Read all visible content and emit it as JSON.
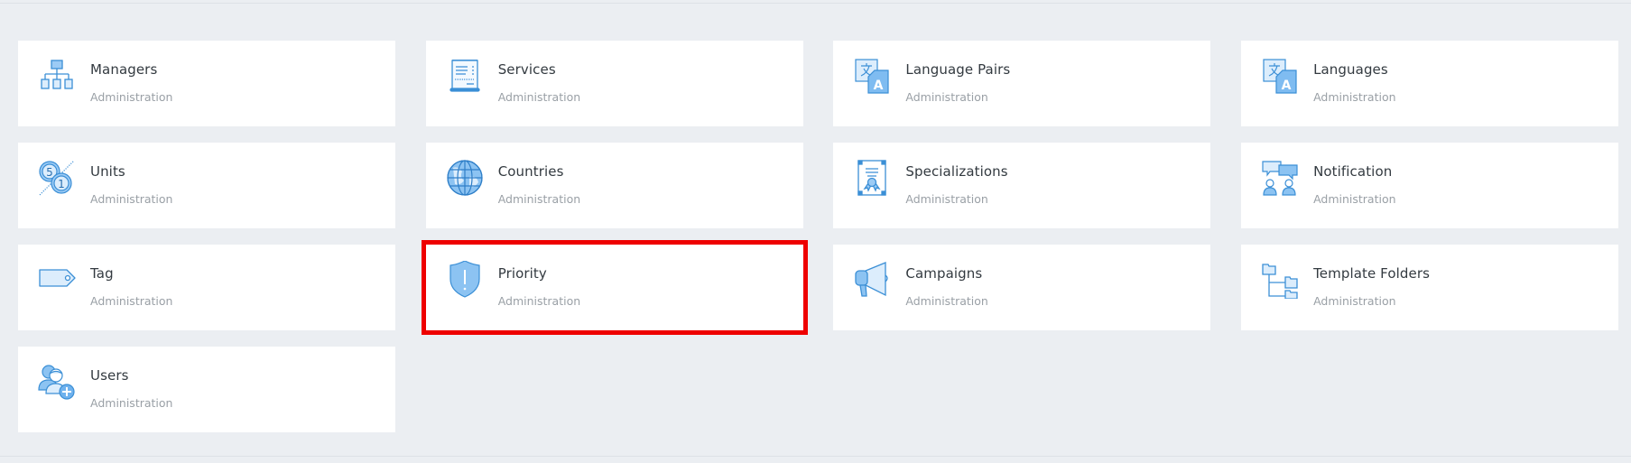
{
  "colors": {
    "background": "#ebeef2",
    "card": "#ffffff",
    "icon_stroke": "#3b8fd6",
    "icon_fill": "#9ccbf5",
    "icon_fill_light": "#dcedfc",
    "highlight": "#ee0000",
    "title": "#333a40",
    "subtitle": "#9aa0a6"
  },
  "cards": [
    {
      "title": "Managers",
      "subtitle": "Administration",
      "icon": "org-chart-icon"
    },
    {
      "title": "Services",
      "subtitle": "Administration",
      "icon": "receipt-icon"
    },
    {
      "title": "Language Pairs",
      "subtitle": "Administration",
      "icon": "translate-icon"
    },
    {
      "title": "Languages",
      "subtitle": "Administration",
      "icon": "translate-icon"
    },
    {
      "title": "Units",
      "subtitle": "Administration",
      "icon": "units-coins-icon"
    },
    {
      "title": "Countries",
      "subtitle": "Administration",
      "icon": "globe-icon"
    },
    {
      "title": "Specializations",
      "subtitle": "Administration",
      "icon": "certificate-icon"
    },
    {
      "title": "Notification",
      "subtitle": "Administration",
      "icon": "chat-users-icon"
    },
    {
      "title": "Tag",
      "subtitle": "Administration",
      "icon": "tag-icon"
    },
    {
      "title": "Priority",
      "subtitle": "Administration",
      "icon": "shield-alert-icon",
      "highlighted": true
    },
    {
      "title": "Campaigns",
      "subtitle": "Administration",
      "icon": "megaphone-icon"
    },
    {
      "title": "Template Folders",
      "subtitle": "Administration",
      "icon": "folder-tree-icon"
    },
    {
      "title": "Users",
      "subtitle": "Administration",
      "icon": "add-user-icon"
    }
  ]
}
